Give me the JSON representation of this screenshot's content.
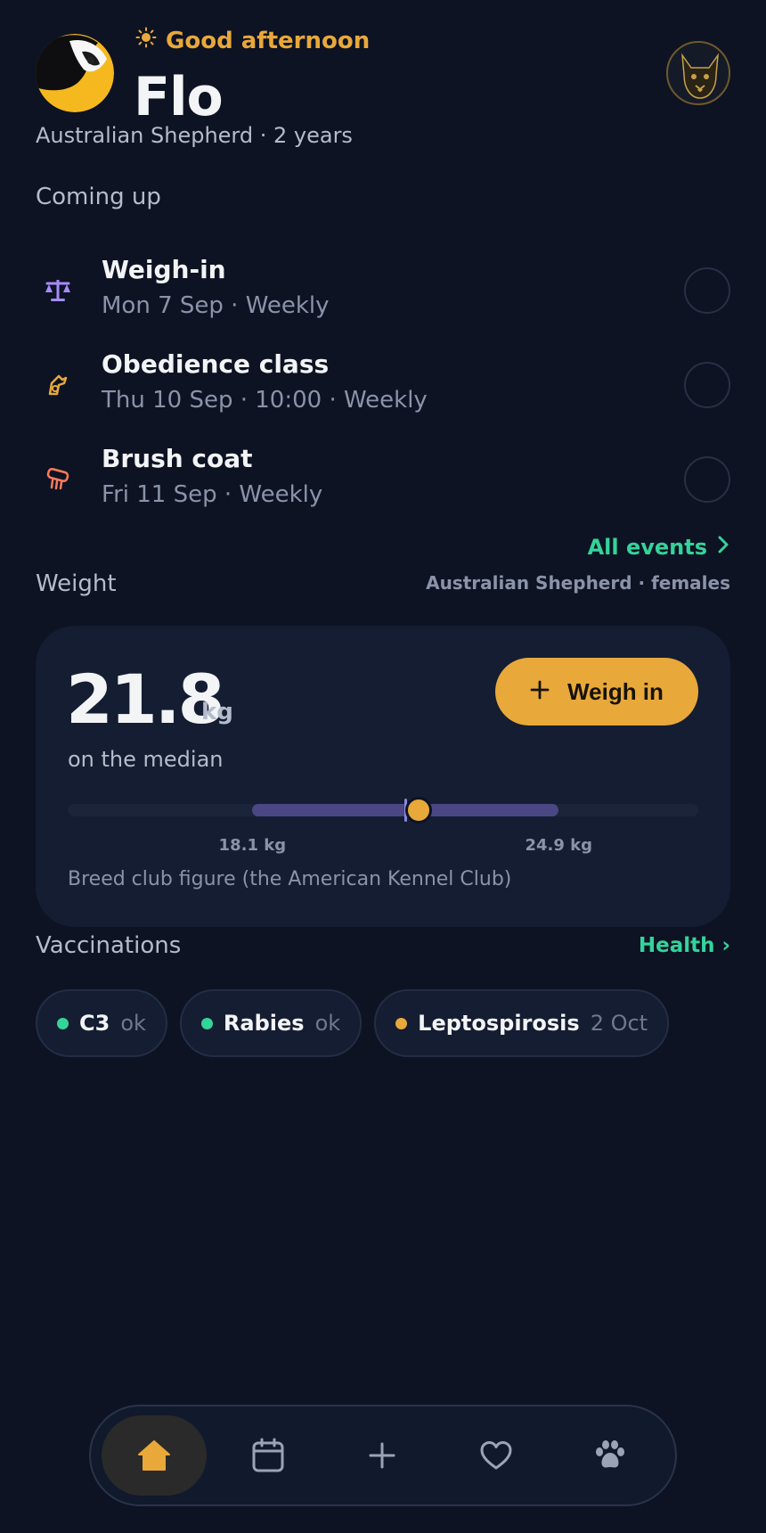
{
  "header": {
    "greeting": "Good afternoon",
    "pet_name": "Flo",
    "pet_details": "Australian Shepherd · 2 years"
  },
  "upcoming": {
    "title": "Coming up",
    "events": [
      {
        "title": "Weigh-in",
        "meta": "Mon 7 Sep · Weekly",
        "icon": "scale-icon",
        "color": "#a78bfa"
      },
      {
        "title": "Obedience class",
        "meta": "Thu 10 Sep · 10:00 · Weekly",
        "icon": "dog-training-icon",
        "color": "#e8a83a"
      },
      {
        "title": "Brush coat",
        "meta": "Fri 11 Sep · Weekly",
        "icon": "brush-icon",
        "color": "#fb7b5b"
      }
    ],
    "all_events_label": "All events"
  },
  "weight": {
    "title": "Weight",
    "breed_ref": "Australian Shepherd · females",
    "value": "21.8",
    "unit": "kg",
    "caption": "on the median",
    "button_label": "Weigh in",
    "range_min_label": "18.1 kg",
    "range_max_label": "24.9 kg",
    "range_min": 18.1,
    "range_max": 24.9,
    "current": 21.8,
    "footnote": "Breed club figure (the American Kennel Club)"
  },
  "vaccinations": {
    "title": "Vaccinations",
    "health_link": "Health ›",
    "items": [
      {
        "name": "C3",
        "status": "ok",
        "color": "#34d399"
      },
      {
        "name": "Rabies",
        "status": "ok",
        "color": "#34d399"
      },
      {
        "name": "Leptospirosis",
        "status": "2 Oct",
        "color": "#e8a83a"
      }
    ]
  },
  "nav": {
    "items": [
      {
        "name": "home-icon",
        "active": true
      },
      {
        "name": "calendar-icon",
        "active": false
      },
      {
        "name": "plus-icon",
        "active": false
      },
      {
        "name": "heart-icon",
        "active": false
      },
      {
        "name": "paw-icon",
        "active": false
      }
    ]
  },
  "colors": {
    "accent": "#e8a83a",
    "success": "#34d399",
    "background": "#0d1323"
  }
}
